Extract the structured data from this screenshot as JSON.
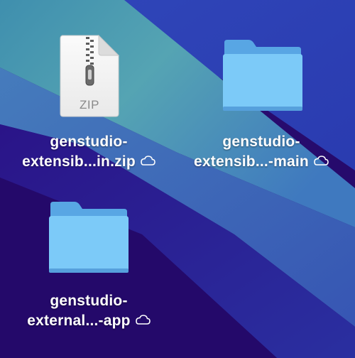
{
  "desktop": {
    "wallpaper_colors": {
      "deep_purple": "#2b0a6e",
      "indigo": "#2a1890",
      "blue": "#3159c4",
      "teal": "#4fa0b0",
      "light_blue": "#4d86c8"
    },
    "items": [
      {
        "kind": "zip-archive",
        "icon": "zip-file-icon",
        "icon_text": "ZIP",
        "label_line1": "genstudio-",
        "label_line2": "extensib...in.zip",
        "status_icon": "icloud-cloud-icon"
      },
      {
        "kind": "folder",
        "icon": "folder-icon",
        "label_line1": "genstudio-",
        "label_line2": "extensib...-main",
        "status_icon": "icloud-cloud-icon"
      },
      {
        "kind": "folder",
        "icon": "folder-icon",
        "label_line1": "genstudio-",
        "label_line2": "external...-app",
        "status_icon": "icloud-cloud-icon"
      }
    ],
    "folder_colors": {
      "front": "#7cc6f7",
      "back": "#5aa8e6",
      "edge": "#4a8fd0"
    }
  }
}
